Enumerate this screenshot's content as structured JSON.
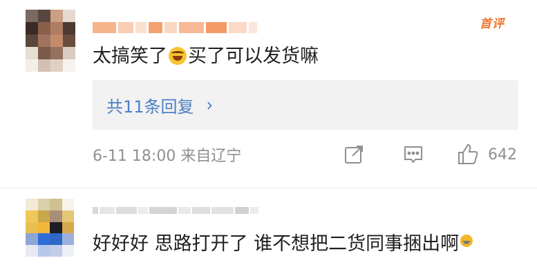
{
  "comment1": {
    "badge": "首评",
    "text_before_emoji": "太搞笑了",
    "emoji": "laugh-emoji",
    "text_after_emoji": "买了可以发货嘛",
    "replies_label": "共11条回复",
    "meta": "6-11 18:00 来自辽宁",
    "like_count": "642"
  },
  "comment2": {
    "text": "好好好 思路打开了 谁不想把二货同事捆出啊",
    "emoji": "emoji-small"
  },
  "colors": {
    "badge": "#f0752c",
    "link": "#4a7fc4",
    "muted": "#8f8f8f",
    "reply_bg": "#f2f2f2"
  }
}
